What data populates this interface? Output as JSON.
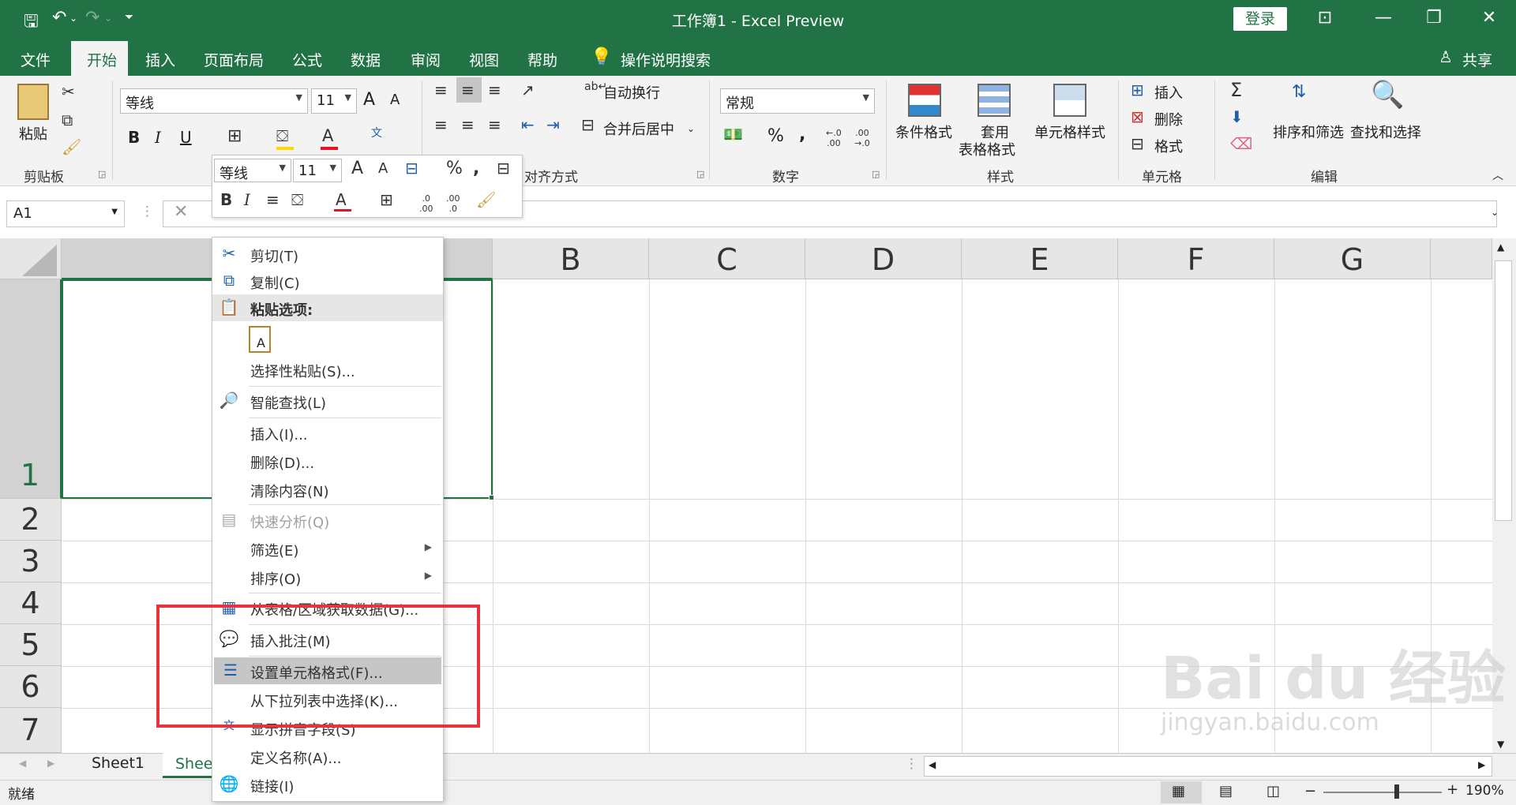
{
  "window": {
    "title": "工作簿1  -  Excel Preview",
    "login_label": "登录",
    "share_label": "共享"
  },
  "tabs": [
    "文件",
    "开始",
    "插入",
    "页面布局",
    "公式",
    "数据",
    "审阅",
    "视图",
    "帮助"
  ],
  "active_tab": "开始",
  "tell_me": "操作说明搜索",
  "ribbon": {
    "clipboard": {
      "paste": "粘贴",
      "group_label": "剪贴板"
    },
    "font": {
      "name": "等线",
      "size": "11",
      "bold": "B",
      "italic": "I",
      "underline": "U",
      "grow": "A",
      "shrink": "A"
    },
    "alignment": {
      "wrap": "自动换行",
      "merge": "合并后居中",
      "group_label": "对齐方式"
    },
    "number": {
      "format": "常规",
      "percent": "%",
      "comma": ",",
      "group_label": "数字"
    },
    "styles": {
      "conditional": "条件格式",
      "table_line1": "套用",
      "table_line2": "表格格式",
      "cell_styles": "单元格样式",
      "group_label": "样式"
    },
    "cells": {
      "insert": "插入",
      "delete": "删除",
      "format": "格式",
      "group_label": "单元格"
    },
    "editing": {
      "sort": "排序和筛选",
      "find": "查找和选择",
      "group_label": "编辑"
    }
  },
  "mini_toolbar": {
    "font": "等线",
    "size": "11"
  },
  "formula_bar": {
    "name_box": "A1",
    "cancel": "✕"
  },
  "columns": [
    "B",
    "C",
    "D",
    "E",
    "F",
    "G"
  ],
  "rows": [
    "1",
    "2",
    "3",
    "4",
    "5",
    "6",
    "7"
  ],
  "context_menu": {
    "items": [
      {
        "label": "剪切(T)",
        "icon": "cut-icon",
        "state": "normal"
      },
      {
        "label": "复制(C)",
        "icon": "copy-icon",
        "state": "normal"
      },
      {
        "label": "粘贴选项:",
        "icon": "paste-icon",
        "state": "header"
      },
      {
        "label": "选择性粘贴(S)...",
        "icon": "",
        "state": "normal"
      },
      {
        "label": "智能查找(L)",
        "icon": "smart-lookup-icon",
        "state": "normal"
      },
      {
        "label": "插入(I)...",
        "icon": "",
        "state": "normal"
      },
      {
        "label": "删除(D)...",
        "icon": "",
        "state": "normal"
      },
      {
        "label": "清除内容(N)",
        "icon": "",
        "state": "normal"
      },
      {
        "label": "快速分析(Q)",
        "icon": "quick-analysis-icon",
        "state": "disabled"
      },
      {
        "label": "筛选(E)",
        "icon": "",
        "state": "submenu"
      },
      {
        "label": "排序(O)",
        "icon": "",
        "state": "submenu"
      },
      {
        "label": "从表格/区域获取数据(G)...",
        "icon": "table-icon",
        "state": "normal"
      },
      {
        "label": "插入批注(M)",
        "icon": "comment-icon",
        "state": "normal"
      },
      {
        "label": "设置单元格格式(F)...",
        "icon": "format-cells-icon",
        "state": "highlighted"
      },
      {
        "label": "从下拉列表中选择(K)...",
        "icon": "",
        "state": "normal"
      },
      {
        "label": "显示拼音字段(S)",
        "icon": "phonetic-icon",
        "state": "normal"
      },
      {
        "label": "定义名称(A)...",
        "icon": "",
        "state": "normal"
      },
      {
        "label": "链接(I)",
        "icon": "link-icon",
        "state": "normal"
      }
    ]
  },
  "sheets": [
    "Sheet1",
    "Shee"
  ],
  "status": {
    "ready": "就绪",
    "zoom": "190%"
  },
  "watermark": {
    "main": "Bai du 经验",
    "sub": "jingyan.baidu.com"
  },
  "colors": {
    "brand": "#217346",
    "highlight_box": "#e8323c"
  }
}
